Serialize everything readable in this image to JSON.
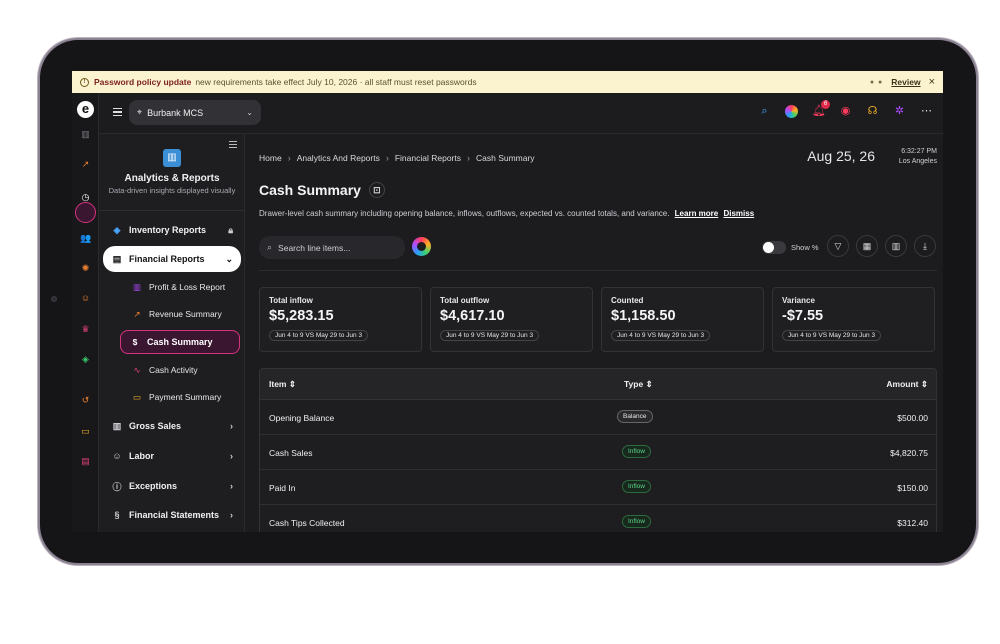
{
  "banner": {
    "title": "Password policy update",
    "message": "new requirements take effect July 10, 2026 · all staff must reset passwords",
    "review": "Review",
    "close": "×"
  },
  "rail": {
    "logo": "e",
    "icons": [
      {
        "name": "bar-chart-icon",
        "glyph": "▥",
        "color": "#7a7a82"
      },
      {
        "name": "trend-icon",
        "glyph": "↗",
        "color": "#f0822e"
      },
      {
        "name": "clock-icon",
        "glyph": "◷",
        "color": "#ffffff"
      },
      {
        "name": "users-icon",
        "glyph": "👥",
        "color": "#b04cff"
      },
      {
        "name": "gear-icon",
        "glyph": "✺",
        "color": "#f0822e"
      },
      {
        "name": "team-icon",
        "glyph": "☺",
        "color": "#f0822e"
      },
      {
        "name": "chef-icon",
        "glyph": "♛",
        "color": "#e0407a"
      },
      {
        "name": "box-icon",
        "glyph": "◈",
        "color": "#3bd16f"
      },
      {
        "name": "history-icon",
        "glyph": "↺",
        "color": "#f0822e"
      },
      {
        "name": "chat-icon",
        "glyph": "▭",
        "color": "#f0b020"
      },
      {
        "name": "report-icon",
        "glyph": "▤",
        "color": "#e0407a"
      }
    ]
  },
  "topbar": {
    "location": "Burbank MCS",
    "notification_count": "6"
  },
  "subnav": {
    "title": "Analytics & Reports",
    "subtitle": "Data-driven insights displayed visually",
    "items": [
      {
        "label": "Inventory Reports"
      },
      {
        "label": "Financial Reports"
      },
      {
        "label": "Gross Sales"
      },
      {
        "label": "Labor"
      },
      {
        "label": "Exceptions"
      },
      {
        "label": "Financial Statements"
      }
    ],
    "subitems": [
      {
        "label": "Profit & Loss Report"
      },
      {
        "label": "Revenue Summary"
      },
      {
        "label": "Cash Summary"
      },
      {
        "label": "Cash Activity"
      },
      {
        "label": "Payment Summary"
      }
    ]
  },
  "breadcrumb": [
    "Home",
    "Analytics And Reports",
    "Financial Reports",
    "Cash Summary"
  ],
  "datetime": {
    "date": "Aug 25, 26",
    "time": "6:32:27 PM",
    "tz": "Los Angeles"
  },
  "page": {
    "title": "Cash Summary",
    "description": "Drawer-level cash summary including opening balance, inflows, outflows, expected vs. counted totals, and variance.",
    "learn_more": "Learn more",
    "dismiss": "Dismiss"
  },
  "search": {
    "placeholder": "Search line items..."
  },
  "toolbar": {
    "show_pct": "Show %"
  },
  "cards": [
    {
      "label": "Total inflow",
      "value": "$5,283.15",
      "compare": "Jun 4 to 9 VS May 29 to Jun 3"
    },
    {
      "label": "Total outflow",
      "value": "$4,617.10",
      "compare": "Jun 4 to 9 VS May 29 to Jun 3"
    },
    {
      "label": "Counted",
      "value": "$1,158.50",
      "compare": "Jun 4 to 9 VS May 29 to Jun 3"
    },
    {
      "label": "Variance",
      "value": "-$7.55",
      "compare": "Jun 4 to 9 VS May 29 to Jun 3"
    }
  ],
  "table": {
    "headers": {
      "item": "Item",
      "type": "Type",
      "amount": "Amount"
    },
    "rows": [
      {
        "item": "Opening Balance",
        "type": "Balance",
        "amount": "$500.00"
      },
      {
        "item": "Cash Sales",
        "type": "Inflow",
        "amount": "$4,820.75"
      },
      {
        "item": "Paid In",
        "type": "Inflow",
        "amount": "$150.00"
      },
      {
        "item": "Cash Tips Collected",
        "type": "Inflow",
        "amount": "$312.40"
      }
    ]
  }
}
